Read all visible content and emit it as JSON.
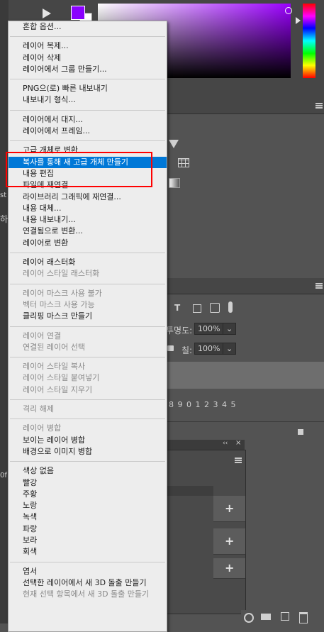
{
  "right_panels": {
    "opacity_label": "투명도:",
    "opacity_value": "100%",
    "lock_label": "칠:",
    "fill_value": "100%",
    "numbers_text": "8 9 0 1 2 3 4 5"
  },
  "left_fragments": [
    "st",
    "하",
    "0f"
  ],
  "menu": {
    "groups": [
      [
        {
          "label": "혼합 옵션...",
          "disabled": false
        }
      ],
      [
        {
          "label": "레이어 복제...",
          "disabled": false
        },
        {
          "label": "레이어 삭제",
          "disabled": false
        },
        {
          "label": "레이어에서 그룹 만들기...",
          "disabled": false
        }
      ],
      [
        {
          "label": "PNG으(로) 빠른 내보내기",
          "disabled": false
        },
        {
          "label": "내보내기 형식...",
          "disabled": false
        }
      ],
      [
        {
          "label": "레이어에서 대지...",
          "disabled": false
        },
        {
          "label": "레이어에서 프레임...",
          "disabled": false
        }
      ],
      [
        {
          "label": "고급 개체로 변환",
          "disabled": false
        },
        {
          "label": "복사를 통해 새 고급 개체 만들기",
          "disabled": false,
          "highlighted": true
        },
        {
          "label": "내용 편집",
          "disabled": false
        },
        {
          "label": "파일에 재연결...",
          "disabled": false
        },
        {
          "label": "라이브러리 그래픽에 재연결...",
          "disabled": false
        },
        {
          "label": "내용 대체...",
          "disabled": false
        },
        {
          "label": "내용 내보내기...",
          "disabled": false
        },
        {
          "label": "연결됨으로 변환...",
          "disabled": false
        },
        {
          "label": "레이어로 변환",
          "disabled": false
        }
      ],
      [
        {
          "label": "레이어 래스터화",
          "disabled": false
        },
        {
          "label": "레이어 스타일 래스터화",
          "disabled": true
        }
      ],
      [
        {
          "label": "레이어 마스크 사용 불가",
          "disabled": true
        },
        {
          "label": "벡터 마스크 사용 가능",
          "disabled": true
        },
        {
          "label": "클리핑 마스크 만들기",
          "disabled": false
        }
      ],
      [
        {
          "label": "레이어 연결",
          "disabled": true
        },
        {
          "label": "연결된 레이어 선택",
          "disabled": true
        }
      ],
      [
        {
          "label": "레이어 스타일 복사",
          "disabled": true
        },
        {
          "label": "레이어 스타일 붙여넣기",
          "disabled": true
        },
        {
          "label": "레이어 스타일 지우기",
          "disabled": true
        }
      ],
      [
        {
          "label": "격리 해제",
          "disabled": true
        }
      ],
      [
        {
          "label": "레이어 병합",
          "disabled": true
        },
        {
          "label": "보이는 레이어 병합",
          "disabled": false
        },
        {
          "label": "배경으로 이미지 병합",
          "disabled": false
        }
      ],
      [
        {
          "label": "색상 없음",
          "disabled": false
        },
        {
          "label": "빨강",
          "disabled": false
        },
        {
          "label": "주황",
          "disabled": false
        },
        {
          "label": "노랑",
          "disabled": false
        },
        {
          "label": "녹색",
          "disabled": false
        },
        {
          "label": "파랑",
          "disabled": false
        },
        {
          "label": "보라",
          "disabled": false
        },
        {
          "label": "회색",
          "disabled": false
        }
      ],
      [
        {
          "label": "엽서",
          "disabled": false
        },
        {
          "label": "선택한 레이어에서 새 3D 돌출 만들기",
          "disabled": false
        },
        {
          "label": "현재 선택 항목에서 새 3D 돌출 만들기",
          "disabled": true
        }
      ]
    ]
  },
  "colors": {
    "foreground": "#8a00ff",
    "highlight": "#0078d7",
    "annotation": "#ff0000"
  }
}
